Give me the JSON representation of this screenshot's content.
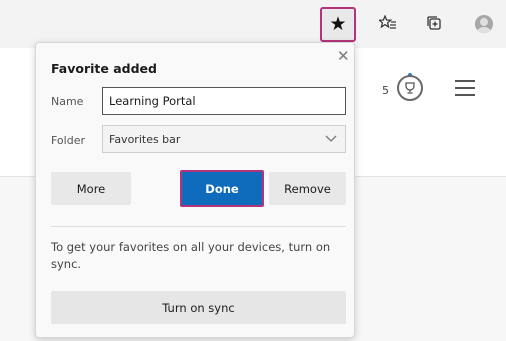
{
  "toolbar": {
    "favorite_icon": "star-filled-icon",
    "collections_icon": "favorites-list-icon",
    "tabs_icon": "collections-icon",
    "profile_icon": "avatar-icon"
  },
  "page": {
    "rewards_count": "5"
  },
  "popup": {
    "title": "Favorite added",
    "close_glyph": "✕",
    "name_label": "Name",
    "name_value": "Learning Portal",
    "folder_label": "Folder",
    "folder_value": "Favorites bar",
    "more_label": "More",
    "done_label": "Done",
    "remove_label": "Remove",
    "sync_text": "To get your favorites on all your devices, turn on sync.",
    "sync_button_label": "Turn on sync"
  },
  "colors": {
    "highlight_border": "#b3347a",
    "done_button": "#0f6cbd"
  }
}
